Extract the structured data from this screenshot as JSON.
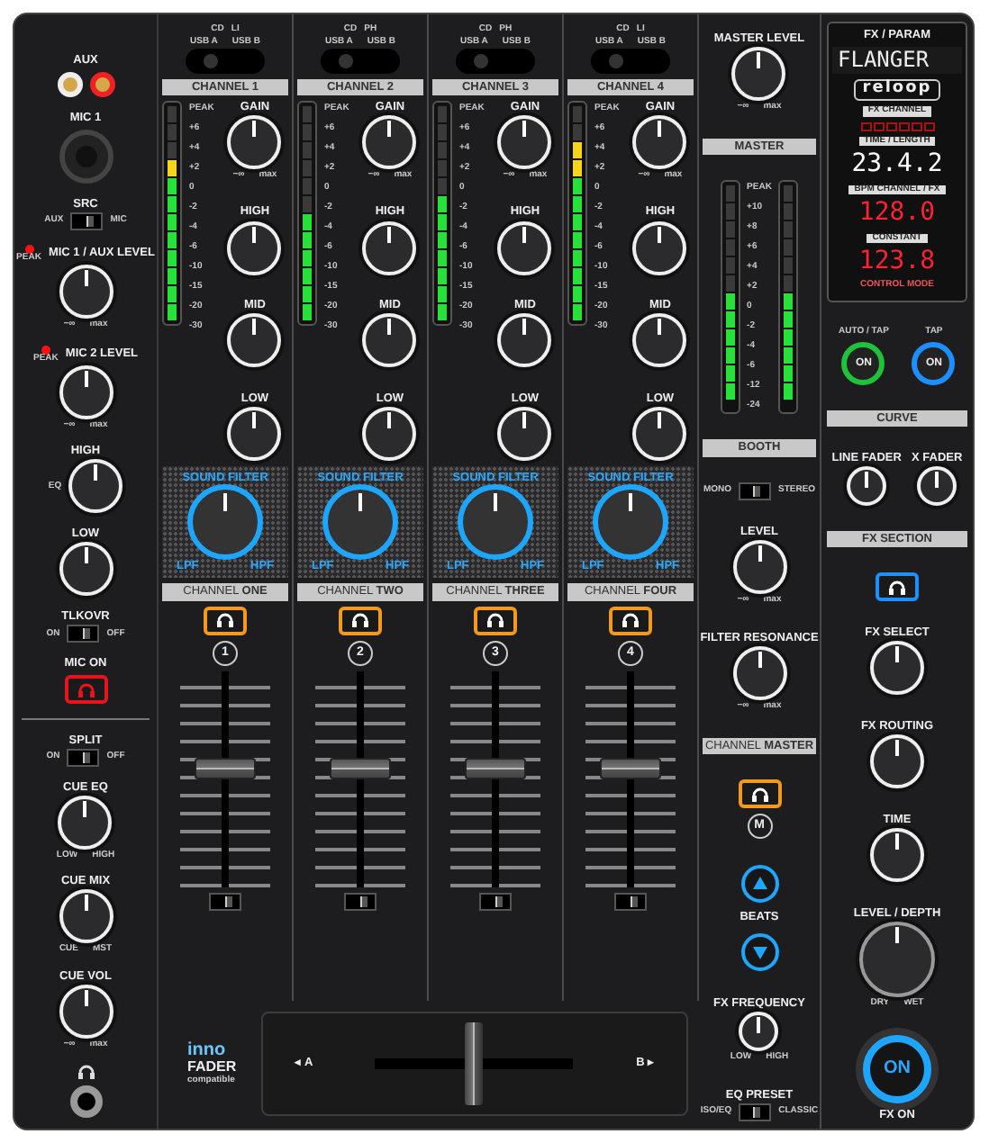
{
  "left": [
    {
      "kind": "rca",
      "label": "AUX"
    },
    {
      "kind": "xlr",
      "label": "MIC 1"
    },
    {
      "kind": "switch",
      "label": "SRC",
      "left": "AUX",
      "right": "MIC",
      "level": 0.6
    },
    {
      "kind": "knob",
      "label": "MIC 1 / AUX LEVEL",
      "peak": "PEAK",
      "min": "−∞",
      "max": "max"
    },
    {
      "kind": "knob",
      "label": "MIC 2 LEVEL",
      "peak": "PEAK",
      "min": "−∞",
      "max": "max"
    },
    {
      "kind": "knob",
      "label": "HIGH",
      "bracket": "EQ"
    },
    {
      "kind": "knob",
      "label": "LOW"
    },
    {
      "kind": "switch",
      "label": "TLKOVR",
      "left": "ON",
      "right": "OFF",
      "level": 0.6
    },
    {
      "kind": "button",
      "label": "MIC ON",
      "color": "#e8141c"
    },
    {
      "kind": "divider"
    },
    {
      "kind": "switch",
      "label": "SPLIT",
      "left": "ON",
      "right": "OFF",
      "level": 0.6
    },
    {
      "kind": "knob",
      "label": "CUE EQ",
      "min": "LOW",
      "max": "HIGH"
    },
    {
      "kind": "knob",
      "label": "CUE MIX",
      "min": "CUE",
      "max": "MST"
    },
    {
      "kind": "knob",
      "label": "CUE VOL",
      "min": "−∞",
      "max": "max"
    },
    {
      "kind": "phones"
    }
  ],
  "channels": [
    {
      "source": {
        "top": [
          "CD",
          "LI"
        ],
        "left": "USB A",
        "right": "USB B"
      },
      "title": "CHANNEL 1",
      "meter": {
        "level": 0.75,
        "scale": [
          "PEAK",
          "+6",
          "+4",
          "+2",
          "0",
          "-2",
          "-4",
          "-6",
          "-10",
          "-15",
          "-20",
          "-30"
        ]
      },
      "knobs": [
        {
          "label": "GAIN",
          "min": "−∞",
          "max": "max"
        },
        {
          "label": "HIGH"
        },
        {
          "label": "MID"
        },
        {
          "label": "LOW"
        }
      ],
      "filter": {
        "label": "SOUND FILTER",
        "left": "LPF",
        "right": "HPF"
      },
      "name": {
        "prefix": "CHANNEL",
        "word": "ONE"
      },
      "number": "1",
      "fader": {
        "level": 0.55
      },
      "curve_switch": {
        "level": 0.6
      }
    },
    {
      "source": {
        "top": [
          "CD",
          "PH"
        ],
        "left": "USB A",
        "right": "USB B"
      },
      "title": "CHANNEL 2",
      "meter": {
        "level": 0.5,
        "scale": [
          "PEAK",
          "+6",
          "+4",
          "+2",
          "0",
          "-2",
          "-4",
          "-6",
          "-10",
          "-15",
          "-20",
          "-30"
        ]
      },
      "knobs": [
        {
          "label": "GAIN",
          "min": "−∞",
          "max": "max"
        },
        {
          "label": "HIGH"
        },
        {
          "label": "MID"
        },
        {
          "label": "LOW"
        }
      ],
      "filter": {
        "label": "SOUND FILTER",
        "left": "LPF",
        "right": "HPF"
      },
      "name": {
        "prefix": "CHANNEL",
        "word": "TWO"
      },
      "number": "2",
      "fader": {
        "level": 0.55
      },
      "curve_switch": {
        "level": 0.6
      }
    },
    {
      "source": {
        "top": [
          "CD",
          "PH"
        ],
        "left": "USB A",
        "right": "USB B"
      },
      "title": "CHANNEL 3",
      "meter": {
        "level": 0.58,
        "scale": [
          "PEAK",
          "+6",
          "+4",
          "+2",
          "0",
          "-2",
          "-4",
          "-6",
          "-10",
          "-15",
          "-20",
          "-30"
        ]
      },
      "knobs": [
        {
          "label": "GAIN",
          "min": "−∞",
          "max": "max"
        },
        {
          "label": "HIGH"
        },
        {
          "label": "MID"
        },
        {
          "label": "LOW"
        }
      ],
      "filter": {
        "label": "SOUND FILTER",
        "left": "LPF",
        "right": "HPF"
      },
      "name": {
        "prefix": "CHANNEL",
        "word": "THREE"
      },
      "number": "3",
      "fader": {
        "level": 0.55
      },
      "curve_switch": {
        "level": 0.6
      }
    },
    {
      "source": {
        "top": [
          "CD",
          "LI"
        ],
        "left": "USB A",
        "right": "USB B"
      },
      "title": "CHANNEL 4",
      "meter": {
        "level": 0.83,
        "scale": [
          "PEAK",
          "+6",
          "+4",
          "+2",
          "0",
          "-2",
          "-4",
          "-6",
          "-10",
          "-15",
          "-20",
          "-30"
        ]
      },
      "knobs": [
        {
          "label": "GAIN",
          "min": "−∞",
          "max": "max"
        },
        {
          "label": "HIGH"
        },
        {
          "label": "MID"
        },
        {
          "label": "LOW"
        }
      ],
      "filter": {
        "label": "SOUND FILTER",
        "left": "LPF",
        "right": "HPF"
      },
      "name": {
        "prefix": "CHANNEL",
        "word": "FOUR"
      },
      "number": "4",
      "fader": {
        "level": 0.55
      },
      "curve_switch": {
        "level": 0.6
      }
    }
  ],
  "crossfader": {
    "left": "◂ A",
    "right": "B ▸",
    "level": 0.5,
    "logo": {
      "brand": "inno",
      "line": "FADER",
      "sub": "compatible"
    }
  },
  "master": [
    {
      "kind": "knob",
      "label": "MASTER LEVEL",
      "min": "−∞",
      "max": "max"
    },
    {
      "kind": "header",
      "label": "MASTER"
    },
    {
      "kind": "meters",
      "levels": [
        {
          "level": 0.5
        },
        {
          "level": 0.5
        }
      ],
      "scale": [
        "PEAK",
        "+10",
        "+8",
        "+6",
        "+4",
        "+2",
        "0",
        "-2",
        "-4",
        "-6",
        "-12",
        "-24"
      ]
    },
    {
      "kind": "header",
      "label": "BOOTH"
    },
    {
      "kind": "switch",
      "left": "MONO",
      "right": "STEREO",
      "level": 0.5
    },
    {
      "kind": "knob",
      "label": "LEVEL",
      "min": "−∞",
      "max": "max"
    },
    {
      "kind": "knob",
      "label": "FILTER RESONANCE",
      "min": "−∞",
      "max": "max"
    },
    {
      "kind": "name",
      "prefix": "CHANNEL",
      "word": "MASTER"
    },
    {
      "kind": "cue",
      "number": "M",
      "color": "#f39a1e"
    },
    {
      "kind": "beats",
      "label": "BEATS"
    },
    {
      "kind": "small_knob",
      "label": "FX FREQUENCY",
      "min": "LOW",
      "max": "HIGH"
    },
    {
      "kind": "switch",
      "label": "EQ PRESET",
      "left": "ISO/EQ",
      "right": "CLASSIC",
      "level": 0.5
    }
  ],
  "fx": [
    {
      "kind": "display",
      "title": "FX / PARAM",
      "effect": "FLANGER",
      "logo": "reloop",
      "fx_channel": "FX CHANNEL",
      "time_label": "TIME / LENGTH",
      "time": "23.4.2",
      "bpm_label": "BPM CHANNEL / FX",
      "bpm": "128.0",
      "constant_label": "CONSTANT",
      "constant": "123.8",
      "mode_label": "CONTROL MODE"
    },
    {
      "kind": "pair",
      "items": [
        {
          "label": "AUTO / TAP",
          "text": "ON",
          "color": "#1fc23a"
        },
        {
          "label": "TAP",
          "text": "ON",
          "color": "#1e8fff"
        }
      ]
    },
    {
      "kind": "header",
      "label": "CURVE"
    },
    {
      "kind": "minis",
      "items": [
        {
          "label": "LINE FADER"
        },
        {
          "label": "X FADER"
        }
      ]
    },
    {
      "kind": "header",
      "label": "FX SECTION"
    },
    {
      "kind": "cue",
      "color": "#1e8fff"
    },
    {
      "kind": "knob",
      "label": "FX SELECT"
    },
    {
      "kind": "knob",
      "label": "FX ROUTING"
    },
    {
      "kind": "knob",
      "label": "TIME"
    },
    {
      "kind": "big_knob",
      "label": "LEVEL / DEPTH",
      "min": "DRY",
      "max": "WET"
    },
    {
      "kind": "on_button",
      "text": "ON",
      "label": "FX ON"
    }
  ]
}
